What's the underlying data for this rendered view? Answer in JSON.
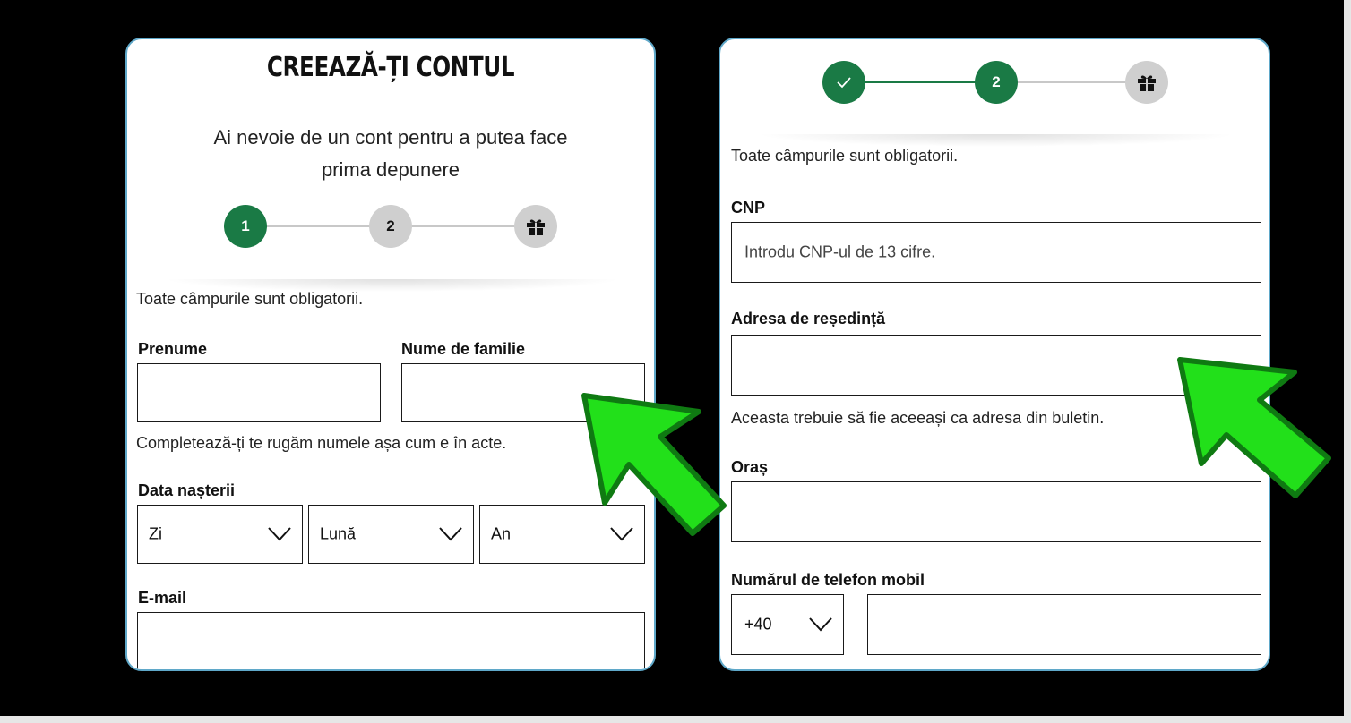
{
  "left_panel": {
    "title": "CREEAZĂ-ȚI CONTUL",
    "subtitle_line1": "Ai nevoie de un cont pentru a putea face",
    "subtitle_line2": "prima depunere",
    "steps": [
      {
        "label": "1",
        "state": "active"
      },
      {
        "label": "2",
        "state": "inactive"
      },
      {
        "icon": "gift-icon",
        "state": "inactive"
      }
    ],
    "required_note": "Toate câmpurile sunt obligatorii.",
    "first_name_label": "Prenume",
    "last_name_label": "Nume de familie",
    "name_helper": "Completează-ți te rugăm numele așa cum e în acte.",
    "dob_label": "Data nașterii",
    "dob_day": "Zi",
    "dob_month": "Lună",
    "dob_year": "An",
    "email_label": "E-mail"
  },
  "right_panel": {
    "steps": [
      {
        "icon": "check-icon",
        "state": "done"
      },
      {
        "label": "2",
        "state": "active"
      },
      {
        "icon": "gift-icon",
        "state": "inactive"
      }
    ],
    "required_note": "Toate câmpurile sunt obligatorii.",
    "cnp_label": "CNP",
    "cnp_placeholder": "Introdu CNP-ul de 13 cifre.",
    "address_label": "Adresa de reședință",
    "address_helper": "Aceasta trebuie să fie aceeași ca adresa din buletin.",
    "city_label": "Oraș",
    "phone_label": "Numărul de telefon mobil",
    "phone_prefix": "+40"
  },
  "colors": {
    "accent_green": "#1a7a45",
    "arrow_green": "#22e01a",
    "inactive_step": "#cfcfcf",
    "panel_border": "#5fa8c9"
  }
}
